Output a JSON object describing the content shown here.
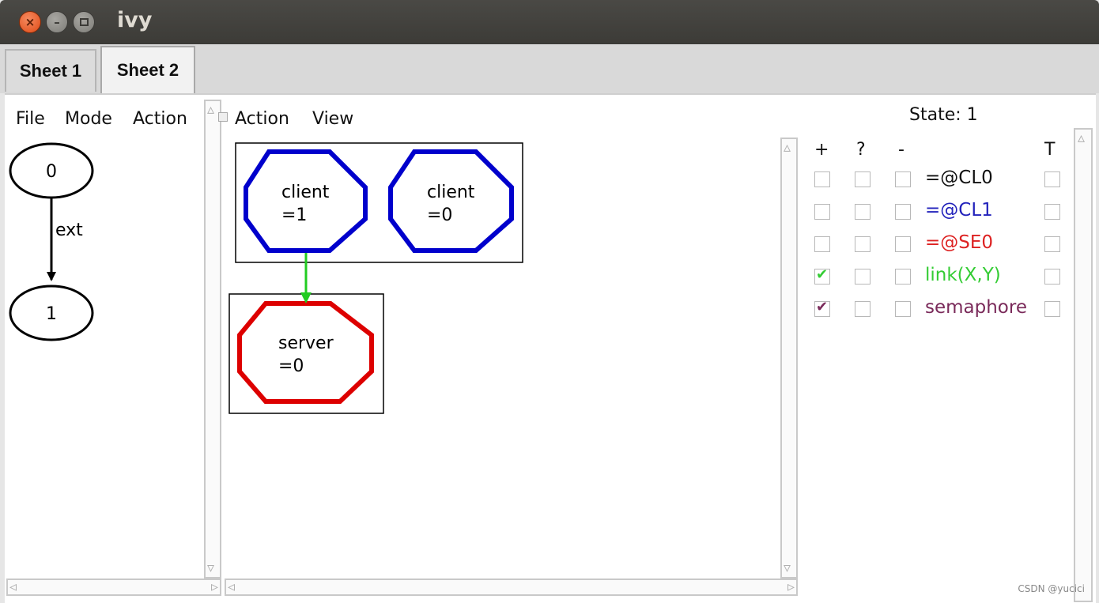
{
  "window": {
    "title": "ivy"
  },
  "tabs": [
    {
      "label": "Sheet 1",
      "active": false
    },
    {
      "label": "Sheet 2",
      "active": true
    }
  ],
  "left_pane": {
    "menu": [
      "File",
      "Mode",
      "Action"
    ],
    "graph": {
      "nodes": [
        "0",
        "1"
      ],
      "edge_label": "ext"
    }
  },
  "center_pane": {
    "menu": [
      "Action",
      "View"
    ],
    "nodes": [
      {
        "line1": "client",
        "line2": "=1",
        "color": "#0000cc"
      },
      {
        "line1": "client",
        "line2": "=0",
        "color": "#0000cc"
      },
      {
        "line1": "server",
        "line2": "=0",
        "color": "#dd0000"
      }
    ],
    "link_color": "#22cc22"
  },
  "right_pane": {
    "state_label": "State: 1",
    "columns": [
      "+",
      "?",
      "-",
      "T"
    ],
    "rows": [
      {
        "label": "=@CL0",
        "color": "#111111",
        "plus": false
      },
      {
        "label": "=@CL1",
        "color": "#2222bb",
        "plus": false
      },
      {
        "label": "=@SE0",
        "color": "#dd2222",
        "plus": false
      },
      {
        "label": "link(X,Y)",
        "color": "#33cc33",
        "plus": true
      },
      {
        "label": "semaphore",
        "color": "#7a2a5a",
        "plus": true
      }
    ]
  },
  "watermark": "CSDN @yucici"
}
